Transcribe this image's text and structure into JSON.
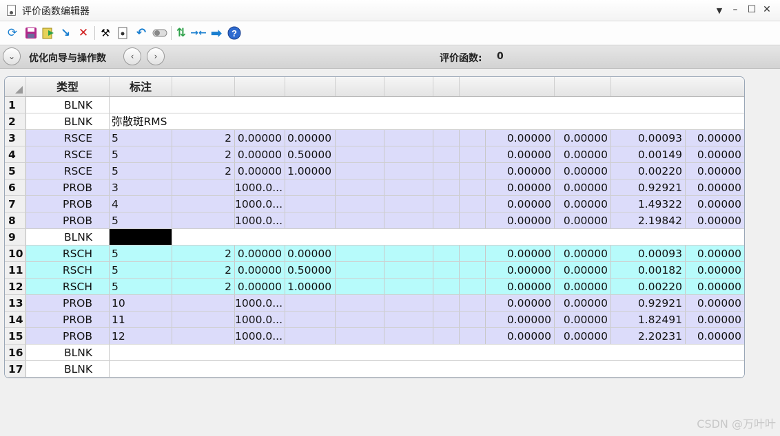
{
  "window": {
    "title": "评价函数编辑器"
  },
  "toolbar_icons": [
    "refresh-icon",
    "save-icon",
    "save-as-icon",
    "load-icon",
    "delete-icon",
    "wizard-icon",
    "insert-icon",
    "undo-icon",
    "toggle-icon",
    "swap-icon",
    "contract-icon",
    "next-icon",
    "help-icon"
  ],
  "nav": {
    "wizard_label": "优化向导与操作数",
    "merit_label": "评价函数:",
    "merit_value": "0"
  },
  "columns": {
    "type": "类型",
    "comment": "标注"
  },
  "rows": [
    {
      "num": "1",
      "type": "BLNK",
      "cells": []
    },
    {
      "num": "2",
      "type": "BLNK",
      "comment": "弥散斑RMS",
      "cells": []
    },
    {
      "num": "3",
      "type": "RSCE",
      "cells": [
        "5",
        "2",
        "0.00000",
        "0.00000",
        "",
        "",
        "",
        "",
        "0.00000",
        "0.00000",
        "0.00093",
        "0.00000"
      ]
    },
    {
      "num": "4",
      "type": "RSCE",
      "cells": [
        "5",
        "2",
        "0.00000",
        "0.50000",
        "",
        "",
        "",
        "",
        "0.00000",
        "0.00000",
        "0.00149",
        "0.00000"
      ]
    },
    {
      "num": "5",
      "type": "RSCE",
      "cells": [
        "5",
        "2",
        "0.00000",
        "1.00000",
        "",
        "",
        "",
        "",
        "0.00000",
        "0.00000",
        "0.00220",
        "0.00000"
      ]
    },
    {
      "num": "6",
      "type": "PROB",
      "cells": [
        "3",
        "",
        "1000.0...",
        "",
        "",
        "",
        "",
        "",
        "0.00000",
        "0.00000",
        "0.92921",
        "0.00000"
      ]
    },
    {
      "num": "7",
      "type": "PROB",
      "cells": [
        "4",
        "",
        "1000.0...",
        "",
        "",
        "",
        "",
        "",
        "0.00000",
        "0.00000",
        "1.49322",
        "0.00000"
      ]
    },
    {
      "num": "8",
      "type": "PROB",
      "cells": [
        "5",
        "",
        "1000.0...",
        "",
        "",
        "",
        "",
        "",
        "0.00000",
        "0.00000",
        "2.19842",
        "0.00000"
      ]
    },
    {
      "num": "9",
      "type": "BLNK",
      "cells": []
    },
    {
      "num": "10",
      "type": "RSCH",
      "cells": [
        "5",
        "2",
        "0.00000",
        "0.00000",
        "",
        "",
        "",
        "",
        "0.00000",
        "0.00000",
        "0.00093",
        "0.00000"
      ]
    },
    {
      "num": "11",
      "type": "RSCH",
      "cells": [
        "5",
        "2",
        "0.00000",
        "0.50000",
        "",
        "",
        "",
        "",
        "0.00000",
        "0.00000",
        "0.00182",
        "0.00000"
      ]
    },
    {
      "num": "12",
      "type": "RSCH",
      "cells": [
        "5",
        "2",
        "0.00000",
        "1.00000",
        "",
        "",
        "",
        "",
        "0.00000",
        "0.00000",
        "0.00220",
        "0.00000"
      ]
    },
    {
      "num": "13",
      "type": "PROB",
      "cells": [
        "10",
        "",
        "1000.0...",
        "",
        "",
        "",
        "",
        "",
        "0.00000",
        "0.00000",
        "0.92921",
        "0.00000"
      ]
    },
    {
      "num": "14",
      "type": "PROB",
      "cells": [
        "11",
        "",
        "1000.0...",
        "",
        "",
        "",
        "",
        "",
        "0.00000",
        "0.00000",
        "1.82491",
        "0.00000"
      ]
    },
    {
      "num": "15",
      "type": "PROB",
      "cells": [
        "12",
        "",
        "1000.0...",
        "",
        "",
        "",
        "",
        "",
        "0.00000",
        "0.00000",
        "2.20231",
        "0.00000"
      ]
    },
    {
      "num": "16",
      "type": "BLNK",
      "cells": []
    },
    {
      "num": "17",
      "type": "BLNK",
      "cells": []
    }
  ],
  "watermark": "CSDN @万叶叶",
  "colors": {
    "blank_row": "#ffffff",
    "operand_row": "#dcdcfa",
    "rsch_row": "#b7fbfb"
  }
}
